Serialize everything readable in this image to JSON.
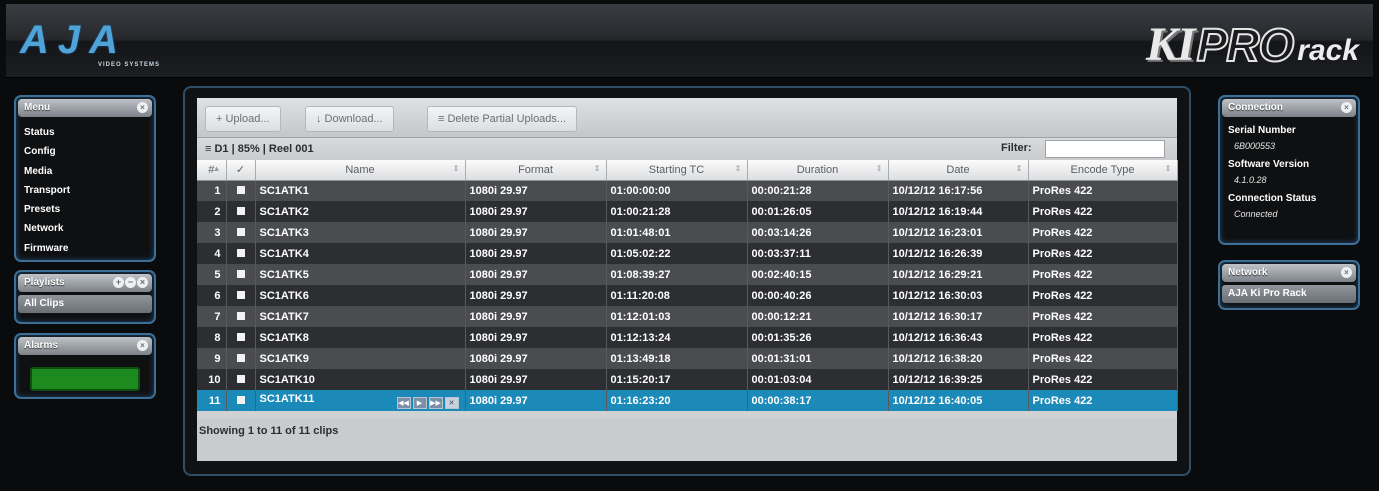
{
  "header": {
    "logo_text": "AJA",
    "logo_sub": "VIDEO SYSTEMS",
    "product_ki": "KI",
    "product_pro": "PRO",
    "product_rack": "rack"
  },
  "menu": {
    "title": "Menu",
    "items": [
      "Status",
      "Config",
      "Media",
      "Transport",
      "Presets",
      "Network",
      "Firmware"
    ]
  },
  "playlists": {
    "title": "Playlists",
    "selected": "All Clips"
  },
  "alarms": {
    "title": "Alarms",
    "status_color": "#1c8a1e"
  },
  "connection": {
    "title": "Connection",
    "serial_label": "Serial Number",
    "serial_value": "6B000553",
    "software_label": "Software Version",
    "software_value": "4.1.0.28",
    "status_label": "Connection Status",
    "status_value": "Connected"
  },
  "network": {
    "title": "Network",
    "device": "AJA Ki Pro Rack"
  },
  "toolbar": {
    "upload": "+ Upload...",
    "download": "↓ Download...",
    "delete_partial": "≡ Delete Partial Uploads..."
  },
  "subbar": {
    "drive_info": "≡ D1  |  85%  |  Reel 001",
    "filter_label": "Filter:",
    "filter_value": ""
  },
  "table": {
    "columns": [
      "#",
      "✓",
      "Name",
      "Format",
      "Starting TC",
      "Duration",
      "Date",
      "Encode Type"
    ],
    "rows": [
      {
        "num": "1",
        "name": "SC1ATK1",
        "format": "1080i 29.97",
        "tc": "01:00:00:00",
        "dur": "00:00:21:28",
        "date": "10/12/12 16:17:56",
        "enc": "ProRes 422"
      },
      {
        "num": "2",
        "name": "SC1ATK2",
        "format": "1080i 29.97",
        "tc": "01:00:21:28",
        "dur": "00:01:26:05",
        "date": "10/12/12 16:19:44",
        "enc": "ProRes 422"
      },
      {
        "num": "3",
        "name": "SC1ATK3",
        "format": "1080i 29.97",
        "tc": "01:01:48:01",
        "dur": "00:03:14:26",
        "date": "10/12/12 16:23:01",
        "enc": "ProRes 422"
      },
      {
        "num": "4",
        "name": "SC1ATK4",
        "format": "1080i 29.97",
        "tc": "01:05:02:22",
        "dur": "00:03:37:11",
        "date": "10/12/12 16:26:39",
        "enc": "ProRes 422"
      },
      {
        "num": "5",
        "name": "SC1ATK5",
        "format": "1080i 29.97",
        "tc": "01:08:39:27",
        "dur": "00:02:40:15",
        "date": "10/12/12 16:29:21",
        "enc": "ProRes 422"
      },
      {
        "num": "6",
        "name": "SC1ATK6",
        "format": "1080i 29.97",
        "tc": "01:11:20:08",
        "dur": "00:00:40:26",
        "date": "10/12/12 16:30:03",
        "enc": "ProRes 422"
      },
      {
        "num": "7",
        "name": "SC1ATK7",
        "format": "1080i 29.97",
        "tc": "01:12:01:03",
        "dur": "00:00:12:21",
        "date": "10/12/12 16:30:17",
        "enc": "ProRes 422"
      },
      {
        "num": "8",
        "name": "SC1ATK8",
        "format": "1080i 29.97",
        "tc": "01:12:13:24",
        "dur": "00:01:35:26",
        "date": "10/12/12 16:36:43",
        "enc": "ProRes 422"
      },
      {
        "num": "9",
        "name": "SC1ATK9",
        "format": "1080i 29.97",
        "tc": "01:13:49:18",
        "dur": "00:01:31:01",
        "date": "10/12/12 16:38:20",
        "enc": "ProRes 422"
      },
      {
        "num": "10",
        "name": "SC1ATK10",
        "format": "1080i 29.97",
        "tc": "01:15:20:17",
        "dur": "00:01:03:04",
        "date": "10/12/12 16:39:25",
        "enc": "ProRes 422"
      },
      {
        "num": "11",
        "name": "SC1ATK11",
        "format": "1080i 29.97",
        "tc": "01:16:23:20",
        "dur": "00:00:38:17",
        "date": "10/12/12 16:40:05",
        "enc": "ProRes 422"
      }
    ],
    "selected_index": 10
  },
  "footer": {
    "status": "Showing 1 to 11 of 11 clips"
  },
  "colors": {
    "accent": "#1c8ab8",
    "panel_border": "#3c6f96",
    "alarm_ok": "#1c8a1e"
  }
}
